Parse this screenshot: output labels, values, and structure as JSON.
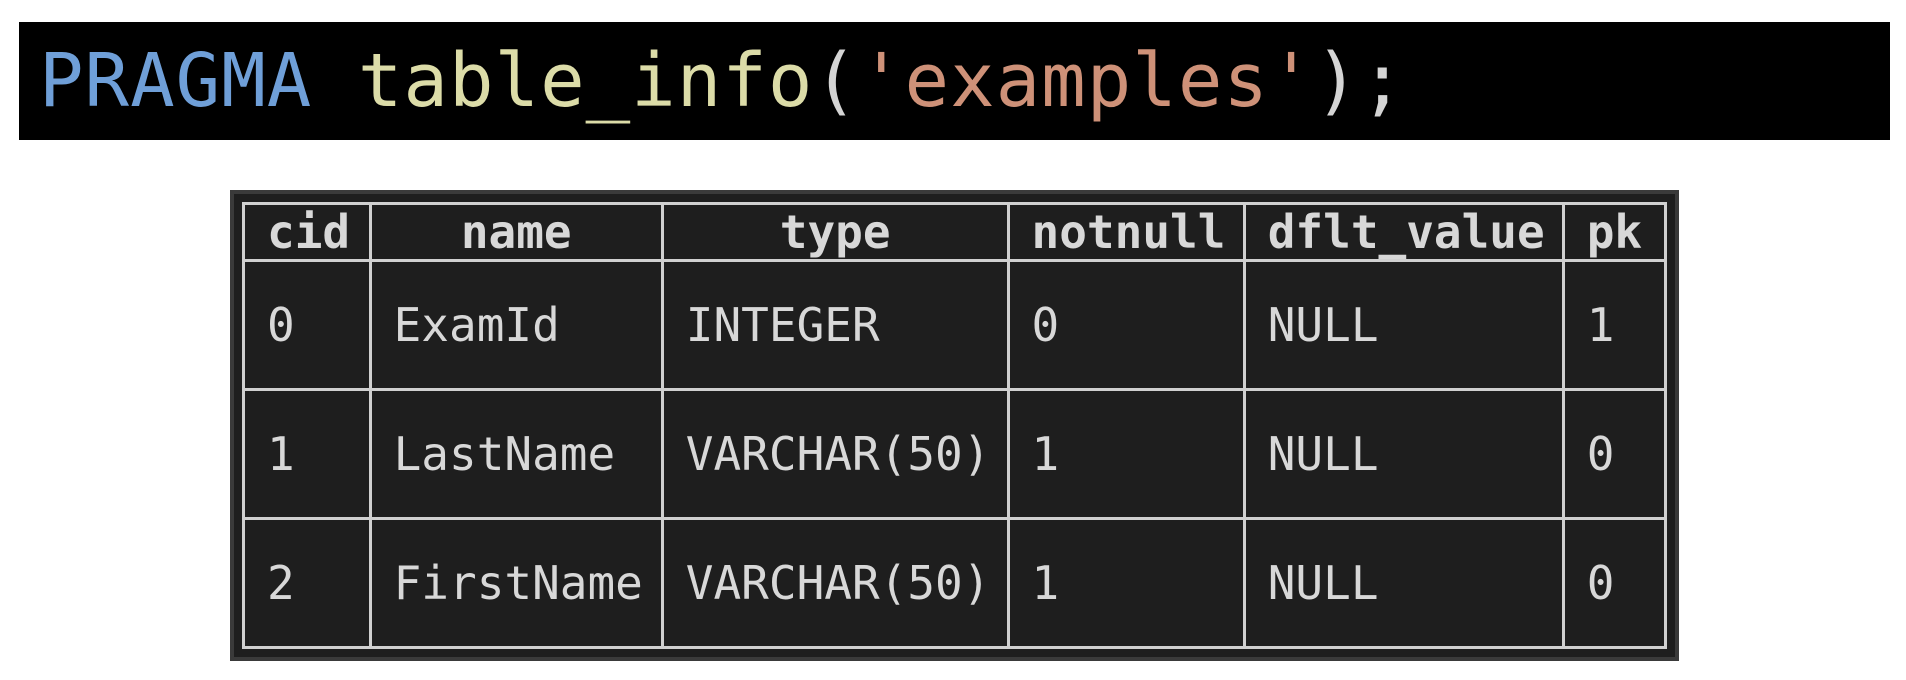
{
  "query": {
    "keyword": "PRAGMA",
    "function": "table_info",
    "open_paren": "(",
    "argument": "'examples'",
    "close": ");"
  },
  "table": {
    "columns": [
      "cid",
      "name",
      "type",
      "notnull",
      "dflt_value",
      "pk"
    ],
    "rows": [
      [
        "0",
        "ExamId",
        "INTEGER",
        "0",
        "NULL",
        "1"
      ],
      [
        "1",
        "LastName",
        "VARCHAR(50)",
        "1",
        "NULL",
        "0"
      ],
      [
        "2",
        "FirstName",
        "VARCHAR(50)",
        "1",
        "NULL",
        "0"
      ]
    ]
  },
  "colors": {
    "keyword": "#6f9fd8",
    "function": "#dcdca8",
    "string": "#ce9178",
    "query_background": "#000000",
    "table_background": "#1e1e1e"
  }
}
